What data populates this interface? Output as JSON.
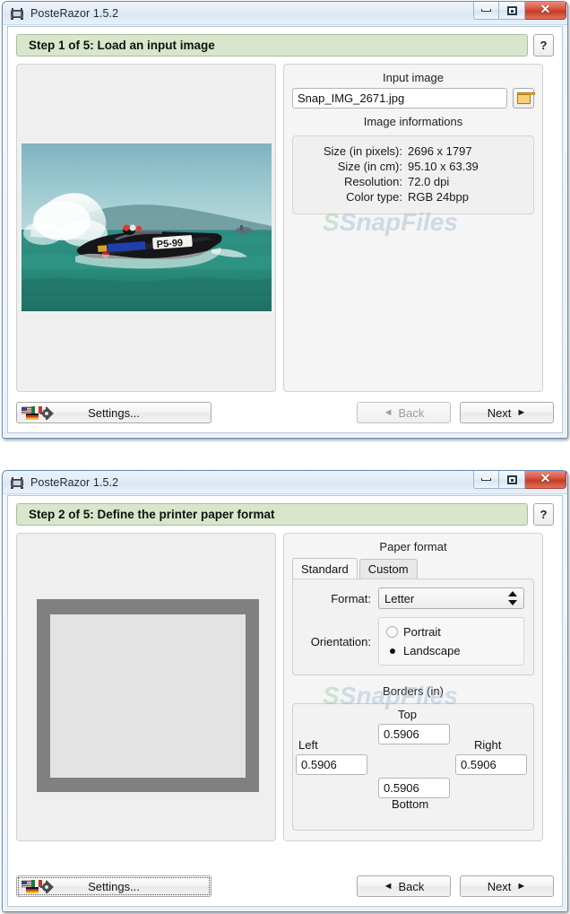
{
  "window1": {
    "title": "PosteRazor 1.5.2",
    "app_icon": "posterazor-icon",
    "controls": {
      "minimize": "minimize-icon",
      "maximize": "maximize-icon",
      "close": "close-icon"
    },
    "step_header": {
      "text": "Step 1 of 5: Load an input image",
      "help_label": "?"
    },
    "input_image": {
      "group_label": "Input image",
      "filename": "Snap_IMG_2671.jpg",
      "browse_icon": "folder-icon"
    },
    "image_information": {
      "group_label": "Image informations",
      "rows": [
        {
          "key": "Size (in pixels):",
          "value": "2696 x 1797"
        },
        {
          "key": "Size (in cm):",
          "value": "95.10 x 63.39"
        },
        {
          "key": "Resolution:",
          "value": "72.0 dpi"
        },
        {
          "key": "Color type:",
          "value": "RGB 24bpp"
        }
      ]
    },
    "footer": {
      "settings_label": "Settings...",
      "settings_icon": "flags-gear-icon",
      "back_label": "Back",
      "next_label": "Next",
      "back_enabled": false
    }
  },
  "window2": {
    "title": "PosteRazor 1.5.2",
    "app_icon": "posterazor-icon",
    "controls": {
      "minimize": "minimize-icon",
      "maximize": "maximize-icon",
      "close": "close-icon"
    },
    "step_header": {
      "text": "Step 2 of 5: Define the printer paper format",
      "help_label": "?"
    },
    "paper_format": {
      "group_label": "Paper format",
      "tabs": [
        {
          "label": "Standard",
          "active": true
        },
        {
          "label": "Custom",
          "active": false
        }
      ],
      "format_label": "Format:",
      "format_value": "Letter",
      "orientation_label": "Orientation:",
      "orientation_options": [
        {
          "label": "Portrait",
          "selected": false
        },
        {
          "label": "Landscape",
          "selected": true
        }
      ]
    },
    "borders": {
      "group_label": "Borders (in)",
      "top_label": "Top",
      "top_value": "0.5906",
      "left_label": "Left",
      "left_value": "0.5906",
      "right_label": "Right",
      "right_value": "0.5906",
      "bottom_label": "Bottom",
      "bottom_value": "0.5906"
    },
    "footer": {
      "settings_label": "Settings...",
      "settings_icon": "flags-gear-icon",
      "back_label": "Back",
      "next_label": "Next",
      "back_enabled": true
    }
  },
  "watermark": {
    "prefix": "S",
    "text": "SnapFiles"
  },
  "colors": {
    "step_header_bg": "#d8e6cc",
    "window_border": "#5f8dbf",
    "close_button": "#c23c26",
    "paper_preview": "#808080"
  }
}
